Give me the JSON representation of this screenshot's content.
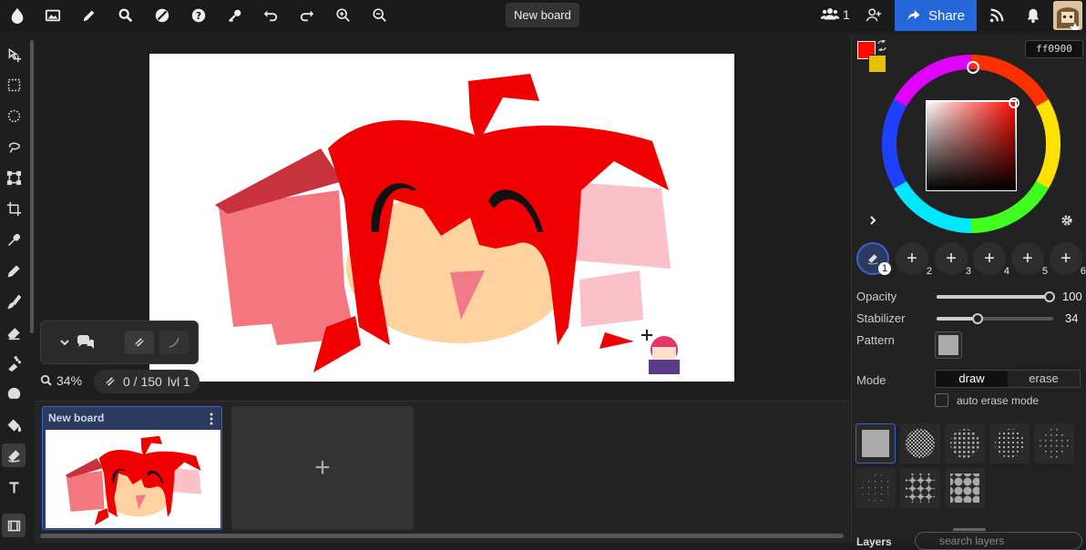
{
  "topbar": {
    "board_title": "New board",
    "user_count": "1",
    "share_label": "Share"
  },
  "colors": {
    "primary": "#ff0900",
    "secondary": "#e8c000",
    "accent": "#2467d8",
    "hex_value": "ff0900"
  },
  "canvas": {
    "zoom": "34%",
    "stroke_count": "0 / 150",
    "level": "lvl 1"
  },
  "timeline": {
    "frames": [
      {
        "title": "New board"
      }
    ],
    "add_label": "+"
  },
  "brush": {
    "slots": [
      "1",
      "2",
      "3",
      "4",
      "5",
      "6"
    ],
    "opacity_label": "Opacity",
    "opacity_value": "100",
    "stabilizer_label": "Stabilizer",
    "stabilizer_value": "34",
    "pattern_label": "Pattern",
    "mode_label": "Mode",
    "mode_draw": "draw",
    "mode_erase": "erase",
    "auto_erase_label": "auto erase mode"
  },
  "layers": {
    "title": "Layers",
    "search_placeholder": "search layers"
  }
}
